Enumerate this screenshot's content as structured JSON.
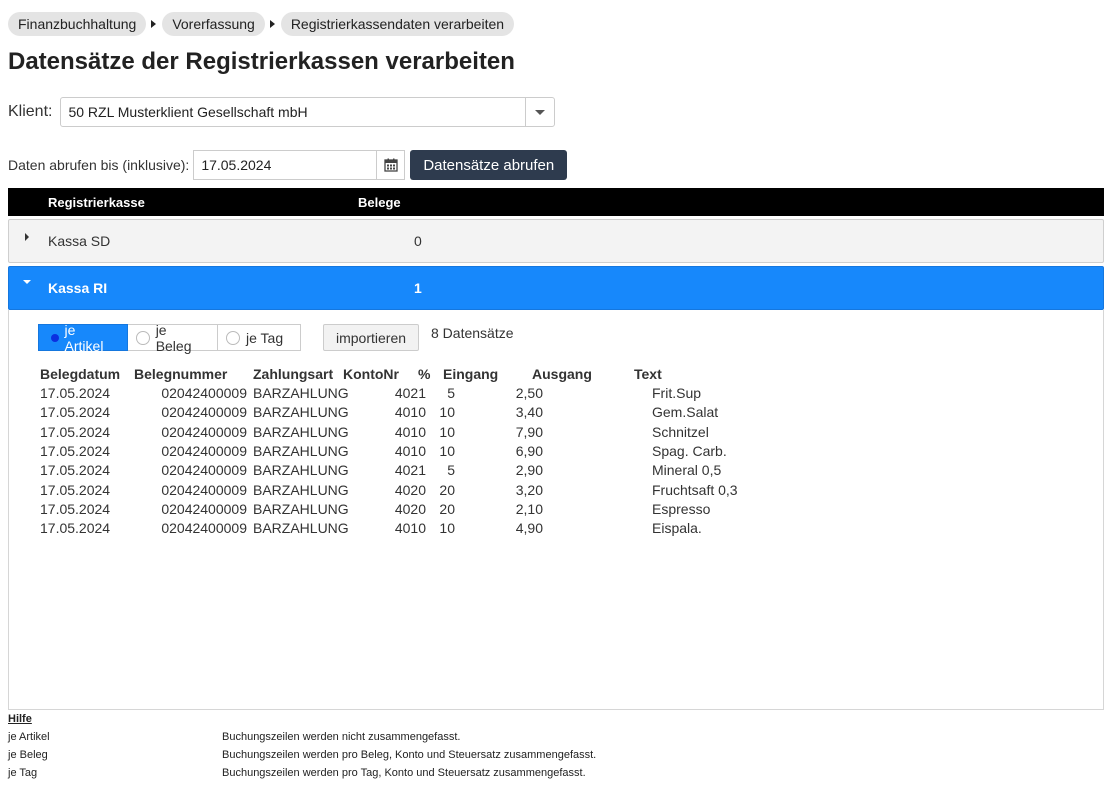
{
  "breadcrumb": [
    "Finanzbuchhaltung",
    "Vorerfassung",
    "Registrierkassendaten verarbeiten"
  ],
  "page_title": "Datensätze der Registrierkassen verarbeiten",
  "client": {
    "label": "Klient:",
    "value": "50 RZL Musterklient Gesellschaft mbH"
  },
  "date_filter": {
    "label": "Daten abrufen bis (inklusive):",
    "value": "17.05.2024",
    "fetch_label": "Datensätze abrufen"
  },
  "grid": {
    "headers": {
      "register": "Registrierkasse",
      "receipts": "Belege"
    },
    "rows": [
      {
        "name": "Kassa SD",
        "count": "0",
        "expanded": false
      },
      {
        "name": "Kassa RI",
        "count": "1",
        "expanded": true
      }
    ]
  },
  "detail": {
    "modes": [
      {
        "label": "je Artikel",
        "selected": true
      },
      {
        "label": "je Beleg",
        "selected": false
      },
      {
        "label": "je Tag",
        "selected": false
      }
    ],
    "import_label": "importieren",
    "record_count": "8 Datensätze",
    "columns": [
      "Belegdatum",
      "Belegnummer",
      "Zahlungsart",
      "KontoNr",
      "%",
      "Eingang",
      "Ausgang",
      "Text"
    ],
    "rows": [
      {
        "date": "17.05.2024",
        "number": "02042400009",
        "payment": "BARZAHLUNG",
        "account": "4021",
        "pct": "5",
        "in": "2,50",
        "out": "",
        "text": "Frit.Sup"
      },
      {
        "date": "17.05.2024",
        "number": "02042400009",
        "payment": "BARZAHLUNG",
        "account": "4010",
        "pct": "10",
        "in": "3,40",
        "out": "",
        "text": "Gem.Salat"
      },
      {
        "date": "17.05.2024",
        "number": "02042400009",
        "payment": "BARZAHLUNG",
        "account": "4010",
        "pct": "10",
        "in": "7,90",
        "out": "",
        "text": "Schnitzel"
      },
      {
        "date": "17.05.2024",
        "number": "02042400009",
        "payment": "BARZAHLUNG",
        "account": "4010",
        "pct": "10",
        "in": "6,90",
        "out": "",
        "text": "Spag. Carb."
      },
      {
        "date": "17.05.2024",
        "number": "02042400009",
        "payment": "BARZAHLUNG",
        "account": "4021",
        "pct": "5",
        "in": "2,90",
        "out": "",
        "text": "Mineral 0,5"
      },
      {
        "date": "17.05.2024",
        "number": "02042400009",
        "payment": "BARZAHLUNG",
        "account": "4020",
        "pct": "20",
        "in": "3,20",
        "out": "",
        "text": "Fruchtsaft 0,3"
      },
      {
        "date": "17.05.2024",
        "number": "02042400009",
        "payment": "BARZAHLUNG",
        "account": "4020",
        "pct": "20",
        "in": "2,10",
        "out": "",
        "text": "Espresso"
      },
      {
        "date": "17.05.2024",
        "number": "02042400009",
        "payment": "BARZAHLUNG",
        "account": "4010",
        "pct": "10",
        "in": "4,90",
        "out": "",
        "text": "Eispala."
      }
    ]
  },
  "help": {
    "title": "Hilfe",
    "items": [
      {
        "term": "je Artikel",
        "desc": "Buchungszeilen werden nicht zusammengefasst."
      },
      {
        "term": "je Beleg",
        "desc": "Buchungszeilen werden pro Beleg, Konto und Steuersatz zusammengefasst."
      },
      {
        "term": "je Tag",
        "desc": "Buchungszeilen werden pro Tag, Konto und Steuersatz zusammengefasst."
      }
    ]
  },
  "colors": {
    "accent": "#1788fb",
    "header_bg": "#000000",
    "button_dark": "#2e3b4e"
  },
  "icons": {
    "calendar": "calendar-icon",
    "dropdown": "chevron-down-icon"
  }
}
